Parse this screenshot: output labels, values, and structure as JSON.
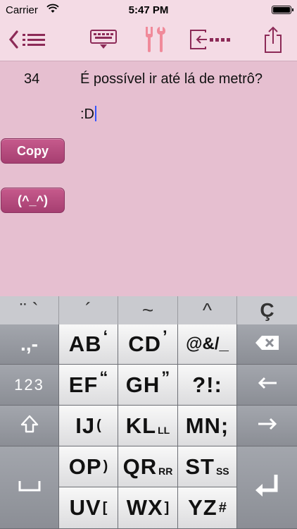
{
  "status": {
    "carrier": "Carrier",
    "time": "5:47 PM"
  },
  "toolbar": {
    "icons": [
      "back-list-icon",
      "keyboard-hide-icon",
      "tools-icon",
      "import-icon",
      "share-icon"
    ]
  },
  "phrase": {
    "number": "34",
    "text": "É possível ir até lá de metrô?",
    "input": ":D"
  },
  "buttons": {
    "copy": "Copy",
    "emoticon": "(^_^)"
  },
  "keyboard": {
    "accents": [
      "¨ `",
      "´",
      "~",
      "^",
      "Ç"
    ],
    "rows": [
      [
        {
          "name": "key-punct",
          "main": ".,-",
          "style": "dark"
        },
        {
          "name": "key-ab",
          "main": "AB",
          "sub": "‘",
          "style": "light"
        },
        {
          "name": "key-cd",
          "main": "CD",
          "sub": "’",
          "style": "light"
        },
        {
          "name": "key-symbols",
          "main": "@&/_",
          "style": "light"
        },
        {
          "name": "key-backspace",
          "main": "⌫",
          "style": "dark"
        }
      ],
      [
        {
          "name": "key-numbers",
          "main": "123",
          "style": "dark"
        },
        {
          "name": "key-ef",
          "main": "EF",
          "sub": "“",
          "style": "light"
        },
        {
          "name": "key-gh",
          "main": "GH",
          "sub": "”",
          "style": "light"
        },
        {
          "name": "key-qmarks",
          "main": "?!:",
          "style": "light"
        },
        {
          "name": "key-left",
          "main": "←",
          "style": "dark"
        }
      ],
      [
        {
          "name": "key-shift",
          "main": "⇧",
          "style": "dark"
        },
        {
          "name": "key-ij",
          "main": "IJ",
          "sub": "(",
          "style": "light"
        },
        {
          "name": "key-kl",
          "main": "KL",
          "sub": "LL",
          "style": "light"
        },
        {
          "name": "key-mn",
          "main": "MN;",
          "style": "light"
        },
        {
          "name": "key-right",
          "main": "→",
          "style": "dark"
        }
      ],
      [
        {
          "name": "key-op",
          "main": "OP",
          "sub": ")",
          "style": "light"
        },
        {
          "name": "key-qr",
          "main": "QR",
          "sub": "RR",
          "style": "light"
        },
        {
          "name": "key-st",
          "main": "ST",
          "sub": "SS",
          "style": "light"
        }
      ],
      [
        {
          "name": "key-uv",
          "main": "UV",
          "sub": "[",
          "style": "light"
        },
        {
          "name": "key-wx",
          "main": "WX",
          "sub": "]",
          "style": "light"
        },
        {
          "name": "key-yz",
          "main": "YZ",
          "sub": "#",
          "style": "light"
        }
      ]
    ],
    "space_icon": "space-icon",
    "return_icon": "return-icon"
  },
  "colors": {
    "accent": "#9b2d5d",
    "button": "#b54a7e",
    "background": "#e6bfd0"
  }
}
